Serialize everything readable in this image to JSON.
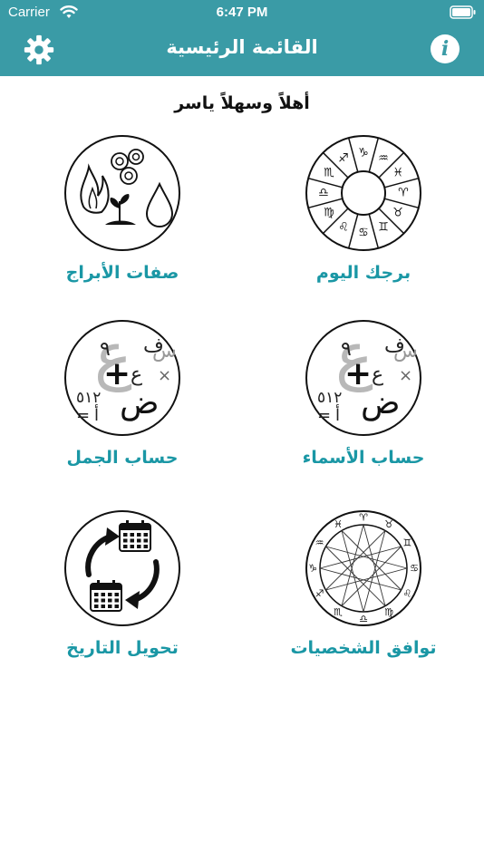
{
  "status": {
    "carrier": "Carrier",
    "time": "6:47 PM"
  },
  "nav": {
    "title": "القائمة الرئيسية",
    "info_glyph": "i"
  },
  "greeting": "أهلاً وسهلاً ياسر",
  "tiles": [
    {
      "label": "برجك اليوم",
      "icon": "zodiac-wheel-icon"
    },
    {
      "label": "صفات الأبراج",
      "icon": "elements-icon"
    },
    {
      "label": "حساب الأسماء",
      "icon": "letters-numbers-icon"
    },
    {
      "label": "حساب الجمل",
      "icon": "letters-numbers-icon"
    },
    {
      "label": "توافق الشخصيات",
      "icon": "zodiac-compatibility-icon"
    },
    {
      "label": "تحويل التاريخ",
      "icon": "calendar-convert-icon"
    }
  ],
  "zodiac_symbols": [
    "♈",
    "♉",
    "♊",
    "♋",
    "♌",
    "♍",
    "♎",
    "♏",
    "♐",
    "♑",
    "♒",
    "♓"
  ],
  "letters_icon": {
    "fa": "ف",
    "nine": "٩",
    "seen": "س",
    "ain": "ع",
    "plus": "+",
    "times": "×",
    "dad": "ض",
    "num": "٥١٢",
    "alif": "أ",
    "eq": "="
  },
  "colors": {
    "brand": "#3a9ba6",
    "label": "#1a97a5"
  }
}
